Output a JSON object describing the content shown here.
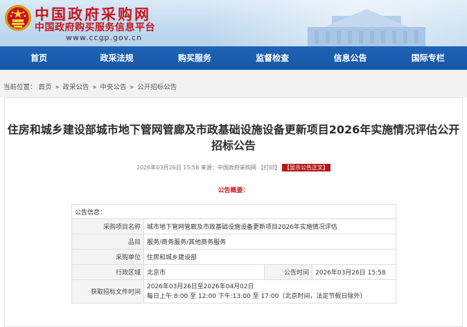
{
  "header": {
    "site_title": "中国政府采购网",
    "site_subtitle": "中国政府购买服务信息平台",
    "site_url": "www.ccgp.gov.cn"
  },
  "nav": [
    {
      "label": "首页"
    },
    {
      "label": "政采法规"
    },
    {
      "label": "购买服务"
    },
    {
      "label": "监督检查"
    },
    {
      "label": "信息公告"
    },
    {
      "label": "国际专栏"
    }
  ],
  "breadcrumb": {
    "prefix": "当前位置：",
    "items": [
      "首页",
      "政采公告",
      "中央公告",
      "公开招标公告"
    ],
    "separator": "»"
  },
  "article": {
    "title": "住房和城乡建设部城市地下管网管廊及市政基础设施设备更新项目2026年实施情况评估公开招标公告",
    "meta_text": "2026年03月26日 15:58 来源：中国政府采购网",
    "print_label": "【打印】",
    "show_body_label": "【显示公告正文】",
    "summary_heading": "公告概要："
  },
  "info_table": {
    "header": "公告信息：",
    "rows": [
      {
        "label": "采购项目名称",
        "value": "城市地下管网管廊及市政基础设施设备更新项目2026年实施情况评估"
      },
      {
        "label": "品目",
        "value": "服务/商务服务/其他商务服务"
      },
      {
        "label": "采购单位",
        "value": "住房和城乡建设部"
      },
      {
        "label": "行政区域",
        "value": "北京市",
        "label2": "公告时间",
        "value2": "2026年03月26日 15:58"
      },
      {
        "label": "获取招标文件时间",
        "value": "2026年03月26日至2026年04月02日",
        "value_line2": "每日上午:8:00 至 12:00  下午:13:00 至 17:00（北京时间，法定节假日除外）"
      }
    ]
  },
  "colors": {
    "brand_red": "#c8161d",
    "nav_blue": "#1a5cae"
  },
  "icons": [
    "national-emblem-icon"
  ]
}
